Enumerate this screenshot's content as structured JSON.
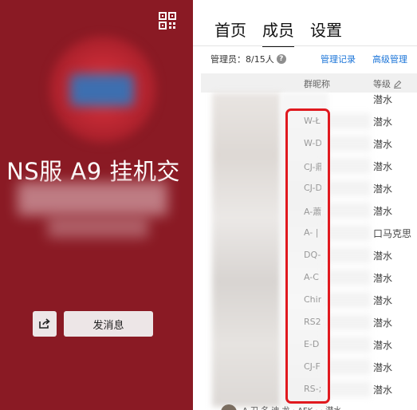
{
  "group": {
    "name": "NS服 A9 挂机交",
    "send_message_label": "发消息"
  },
  "tabs": [
    {
      "label": "首页",
      "active": false
    },
    {
      "label": "成员",
      "active": true
    },
    {
      "label": "设置",
      "active": false
    }
  ],
  "admin": {
    "label": "管理员：8/15人",
    "help": "?"
  },
  "links": {
    "manage_log": "管理记录",
    "advanced": "高级管理"
  },
  "table": {
    "nickname_header": "群昵称",
    "level_header": "等级"
  },
  "members": [
    {
      "nick": "",
      "level": "潜水"
    },
    {
      "nick": "W-Ł",
      "level": "潜水"
    },
    {
      "nick": "W-D",
      "level": "潜水"
    },
    {
      "nick": "CJ-鼎",
      "level": "潜水"
    },
    {
      "nick": "CJ-D",
      "level": "潜水"
    },
    {
      "nick": "A-蕭",
      "level": "潜水"
    },
    {
      "nick": "A- |",
      "level": "口马克思"
    },
    {
      "nick": "DQ-",
      "level": "潜水"
    },
    {
      "nick": "A-C",
      "level": "潜水"
    },
    {
      "nick": "Chir",
      "level": "潜水"
    },
    {
      "nick": "RS2",
      "level": "潜水"
    },
    {
      "nick": "E-D",
      "level": "潜水"
    },
    {
      "nick": "CJ-F",
      "level": "潜水"
    },
    {
      "nick": "RS-;",
      "level": "潜水"
    }
  ],
  "bottom_row": "A 刀 名 迪 龙 ·   AFK  ·  ·  潜水",
  "colors": {
    "left_panel": "#8a1a24",
    "highlight": "#e0191f",
    "link": "#1a74d8"
  }
}
